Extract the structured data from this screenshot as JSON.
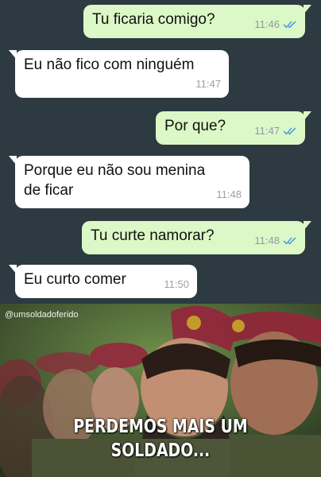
{
  "messages": [
    {
      "text": "Tu ficaria comigo?",
      "time": "11:46",
      "side": "out"
    },
    {
      "text": "Eu não fico com ninguém",
      "time": "11:47",
      "side": "in"
    },
    {
      "text": "Por que?",
      "time": "11:47",
      "side": "out"
    },
    {
      "text_line1": "Porque eu não sou menina",
      "text_line2": "de ficar",
      "time": "11:48",
      "side": "in"
    },
    {
      "text": "Tu curte namorar?",
      "time": "11:48",
      "side": "out"
    },
    {
      "text": "Eu curto comer",
      "time": "11:50",
      "side": "in"
    }
  ],
  "colors": {
    "chat_background": "#2d3a41",
    "outgoing_bubble": "#dcf8c6",
    "incoming_bubble": "#ffffff",
    "read_ticks": "#4fa3e0"
  },
  "meme": {
    "credit": "@umsoldadoferido",
    "caption_line1": "PERDEMOS MAIS UM",
    "caption_line2": "SOLDADO..."
  }
}
